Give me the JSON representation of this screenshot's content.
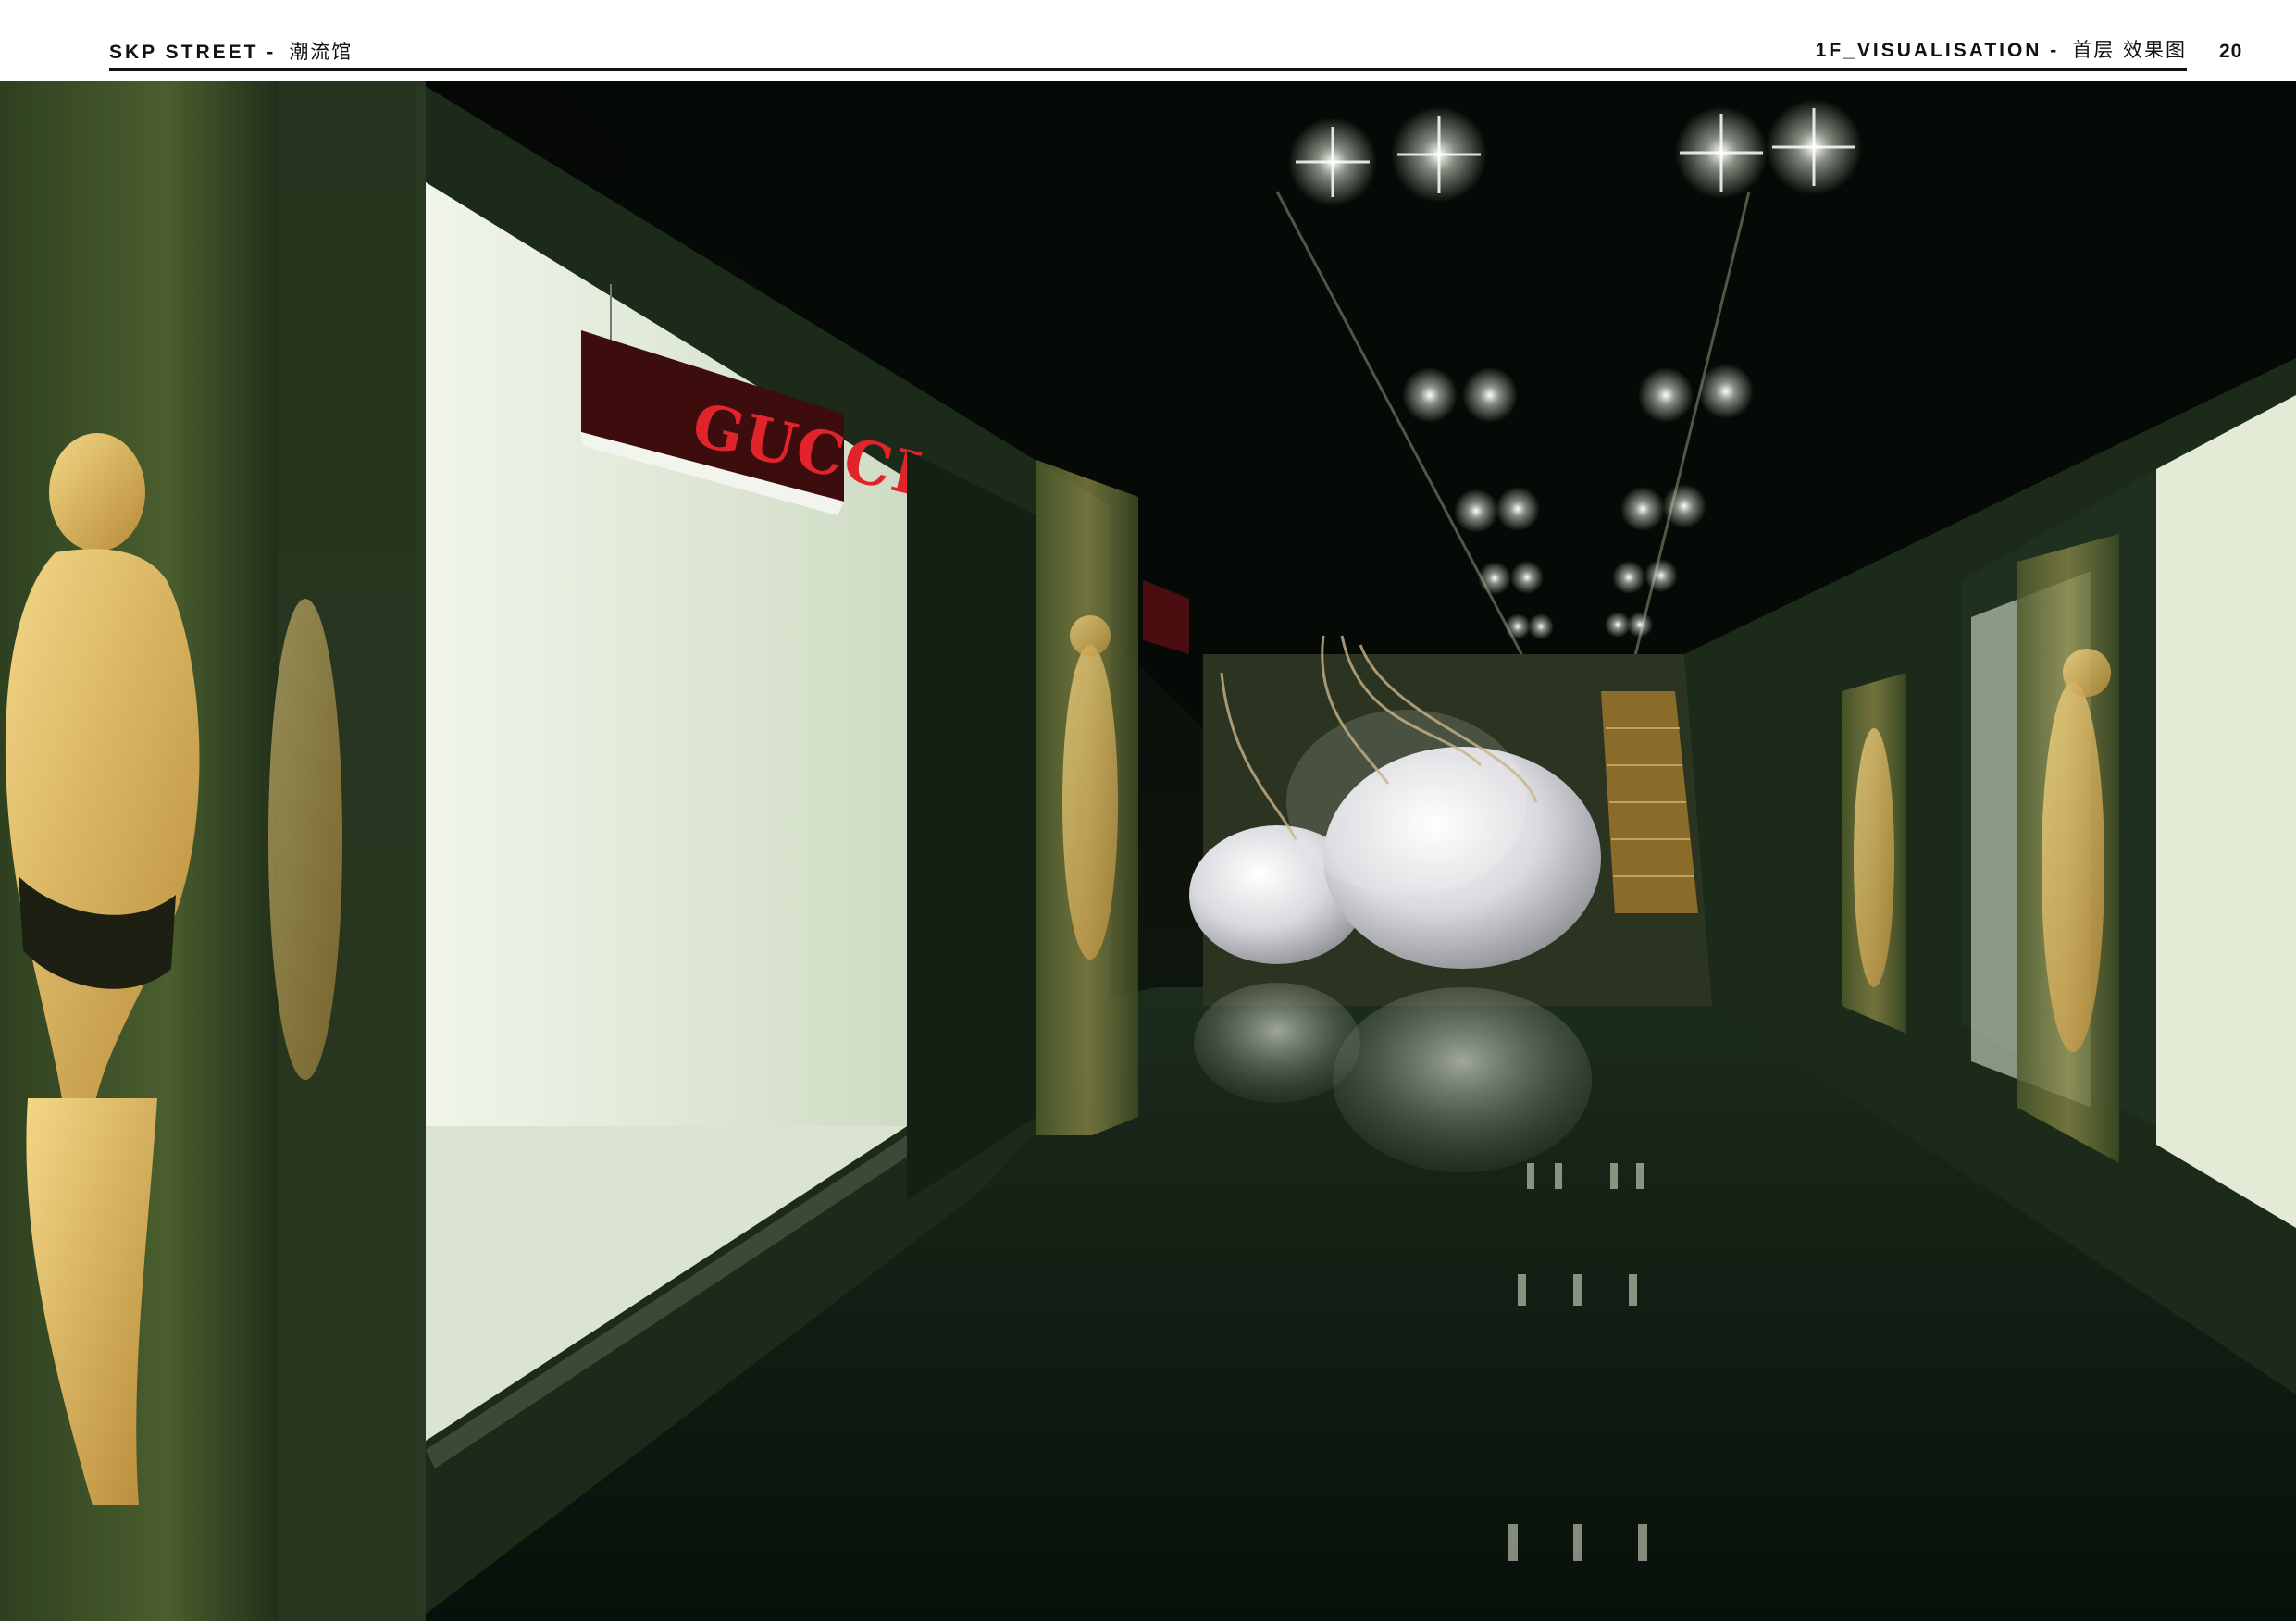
{
  "header": {
    "left_title": "SKP STREET -",
    "left_title_cn": "潮流馆",
    "right_title": "1F_VISUALISATION -",
    "right_title_cn": "首层 效果图",
    "page_number": "20"
  },
  "render": {
    "sign_text": "GUCCI",
    "colors": {
      "ceiling": "#050805",
      "wall_green": "#1b2a19",
      "shopfront_white": "#e9efe0",
      "floor_dark": "#0c1a10",
      "mannequin_gold": "#d9b45a",
      "sign_red": "#e0242a",
      "sphere_white": "#e6e6ea"
    }
  }
}
